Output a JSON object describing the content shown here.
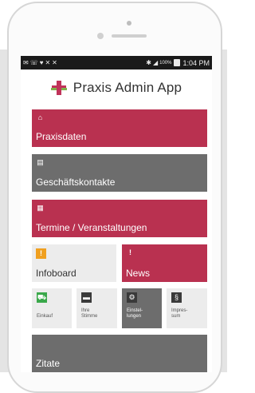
{
  "status_bar": {
    "left_icons": [
      "✉",
      "☏",
      "♥",
      "✕",
      "✕"
    ],
    "right_text": "1:04 PM",
    "battery_text": "100%"
  },
  "app": {
    "title": "Praxis Admin App"
  },
  "tiles": {
    "praxisdaten": {
      "label": "Praxisdaten",
      "icon": "⌂"
    },
    "geschaeftskontakte": {
      "label": "Geschäftskontakte",
      "icon": "▤"
    },
    "termine": {
      "label": "Termine / Veranstaltungen",
      "icon": "▦"
    },
    "infoboard": {
      "label": "Infoboard",
      "icon": "!"
    },
    "news": {
      "label": "News",
      "icon": "!"
    },
    "einkauf": {
      "label": "Einkauf",
      "icon": "⛟"
    },
    "stimme": {
      "label": "Ihre Stimme",
      "icon": "▬"
    },
    "einstellungen": {
      "label": "Einstel-lungen",
      "icon": "⚙"
    },
    "impressum": {
      "label": "Impres-sum",
      "icon": "§"
    },
    "zitate": {
      "label": "Zitate"
    }
  },
  "colors": {
    "red_tile": "#b93150",
    "gray_tile": "#6d6d6d",
    "orange_icon": "#f0a020",
    "green_icon": "#3aa84a"
  }
}
